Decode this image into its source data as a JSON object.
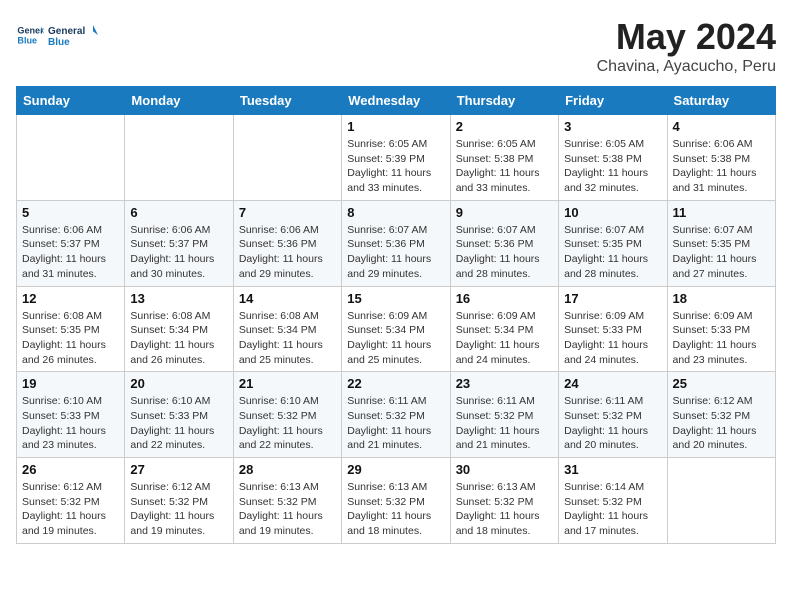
{
  "logo": {
    "line1": "General",
    "line2": "Blue"
  },
  "title": "May 2024",
  "subtitle": "Chavina, Ayacucho, Peru",
  "weekdays": [
    "Sunday",
    "Monday",
    "Tuesday",
    "Wednesday",
    "Thursday",
    "Friday",
    "Saturday"
  ],
  "weeks": [
    [
      {
        "day": "",
        "info": ""
      },
      {
        "day": "",
        "info": ""
      },
      {
        "day": "",
        "info": ""
      },
      {
        "day": "1",
        "info": "Sunrise: 6:05 AM\nSunset: 5:39 PM\nDaylight: 11 hours and 33 minutes."
      },
      {
        "day": "2",
        "info": "Sunrise: 6:05 AM\nSunset: 5:38 PM\nDaylight: 11 hours and 33 minutes."
      },
      {
        "day": "3",
        "info": "Sunrise: 6:05 AM\nSunset: 5:38 PM\nDaylight: 11 hours and 32 minutes."
      },
      {
        "day": "4",
        "info": "Sunrise: 6:06 AM\nSunset: 5:38 PM\nDaylight: 11 hours and 31 minutes."
      }
    ],
    [
      {
        "day": "5",
        "info": "Sunrise: 6:06 AM\nSunset: 5:37 PM\nDaylight: 11 hours and 31 minutes."
      },
      {
        "day": "6",
        "info": "Sunrise: 6:06 AM\nSunset: 5:37 PM\nDaylight: 11 hours and 30 minutes."
      },
      {
        "day": "7",
        "info": "Sunrise: 6:06 AM\nSunset: 5:36 PM\nDaylight: 11 hours and 29 minutes."
      },
      {
        "day": "8",
        "info": "Sunrise: 6:07 AM\nSunset: 5:36 PM\nDaylight: 11 hours and 29 minutes."
      },
      {
        "day": "9",
        "info": "Sunrise: 6:07 AM\nSunset: 5:36 PM\nDaylight: 11 hours and 28 minutes."
      },
      {
        "day": "10",
        "info": "Sunrise: 6:07 AM\nSunset: 5:35 PM\nDaylight: 11 hours and 28 minutes."
      },
      {
        "day": "11",
        "info": "Sunrise: 6:07 AM\nSunset: 5:35 PM\nDaylight: 11 hours and 27 minutes."
      }
    ],
    [
      {
        "day": "12",
        "info": "Sunrise: 6:08 AM\nSunset: 5:35 PM\nDaylight: 11 hours and 26 minutes."
      },
      {
        "day": "13",
        "info": "Sunrise: 6:08 AM\nSunset: 5:34 PM\nDaylight: 11 hours and 26 minutes."
      },
      {
        "day": "14",
        "info": "Sunrise: 6:08 AM\nSunset: 5:34 PM\nDaylight: 11 hours and 25 minutes."
      },
      {
        "day": "15",
        "info": "Sunrise: 6:09 AM\nSunset: 5:34 PM\nDaylight: 11 hours and 25 minutes."
      },
      {
        "day": "16",
        "info": "Sunrise: 6:09 AM\nSunset: 5:34 PM\nDaylight: 11 hours and 24 minutes."
      },
      {
        "day": "17",
        "info": "Sunrise: 6:09 AM\nSunset: 5:33 PM\nDaylight: 11 hours and 24 minutes."
      },
      {
        "day": "18",
        "info": "Sunrise: 6:09 AM\nSunset: 5:33 PM\nDaylight: 11 hours and 23 minutes."
      }
    ],
    [
      {
        "day": "19",
        "info": "Sunrise: 6:10 AM\nSunset: 5:33 PM\nDaylight: 11 hours and 23 minutes."
      },
      {
        "day": "20",
        "info": "Sunrise: 6:10 AM\nSunset: 5:33 PM\nDaylight: 11 hours and 22 minutes."
      },
      {
        "day": "21",
        "info": "Sunrise: 6:10 AM\nSunset: 5:32 PM\nDaylight: 11 hours and 22 minutes."
      },
      {
        "day": "22",
        "info": "Sunrise: 6:11 AM\nSunset: 5:32 PM\nDaylight: 11 hours and 21 minutes."
      },
      {
        "day": "23",
        "info": "Sunrise: 6:11 AM\nSunset: 5:32 PM\nDaylight: 11 hours and 21 minutes."
      },
      {
        "day": "24",
        "info": "Sunrise: 6:11 AM\nSunset: 5:32 PM\nDaylight: 11 hours and 20 minutes."
      },
      {
        "day": "25",
        "info": "Sunrise: 6:12 AM\nSunset: 5:32 PM\nDaylight: 11 hours and 20 minutes."
      }
    ],
    [
      {
        "day": "26",
        "info": "Sunrise: 6:12 AM\nSunset: 5:32 PM\nDaylight: 11 hours and 19 minutes."
      },
      {
        "day": "27",
        "info": "Sunrise: 6:12 AM\nSunset: 5:32 PM\nDaylight: 11 hours and 19 minutes."
      },
      {
        "day": "28",
        "info": "Sunrise: 6:13 AM\nSunset: 5:32 PM\nDaylight: 11 hours and 19 minutes."
      },
      {
        "day": "29",
        "info": "Sunrise: 6:13 AM\nSunset: 5:32 PM\nDaylight: 11 hours and 18 minutes."
      },
      {
        "day": "30",
        "info": "Sunrise: 6:13 AM\nSunset: 5:32 PM\nDaylight: 11 hours and 18 minutes."
      },
      {
        "day": "31",
        "info": "Sunrise: 6:14 AM\nSunset: 5:32 PM\nDaylight: 11 hours and 17 minutes."
      },
      {
        "day": "",
        "info": ""
      }
    ]
  ]
}
